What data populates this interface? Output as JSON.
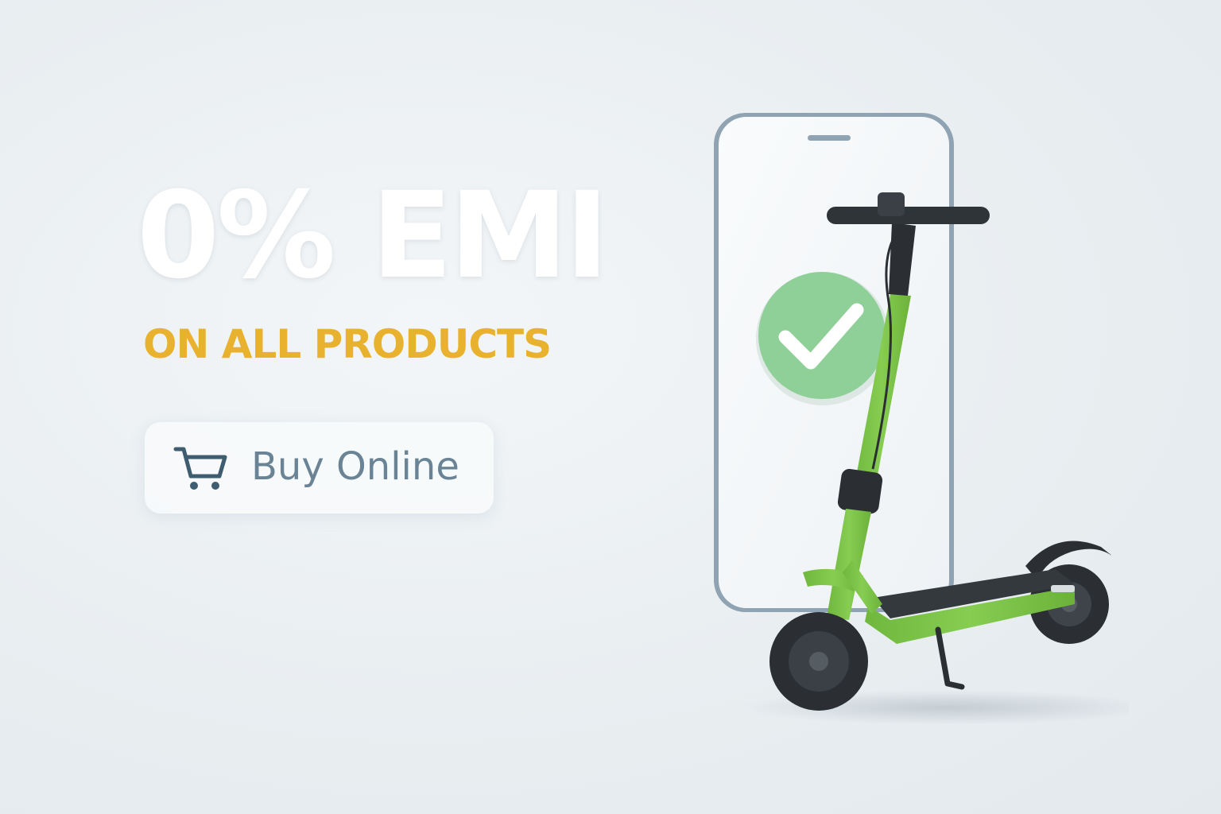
{
  "promo": {
    "headline": "0% EMI",
    "subheadline": "ON ALL PRODUCTS",
    "cta": {
      "label": "Buy Online",
      "icon": "shopping-cart-icon"
    }
  },
  "illustration": {
    "phone_icon": "smartphone",
    "check_icon": "check-circle-icon",
    "product": "electric-scooter"
  },
  "colors": {
    "headline": "#ffffff",
    "subheadline": "#e8b22e",
    "cta_text": "#6a8496",
    "scooter_green": "#7cc448",
    "check_green": "#8fcf98"
  }
}
